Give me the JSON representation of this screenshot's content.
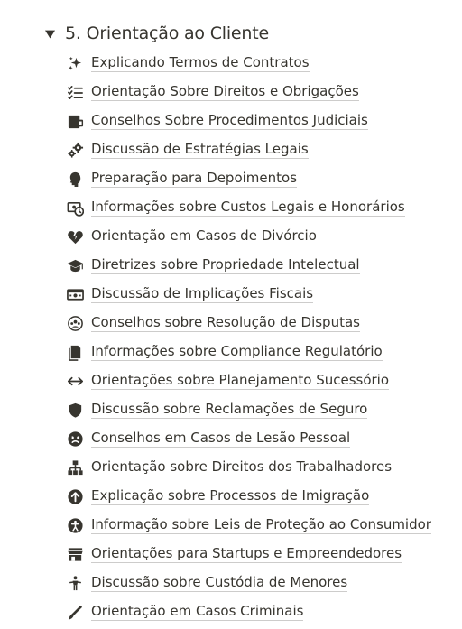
{
  "section": {
    "title": "5. Orientação ao Cliente",
    "expanded": true
  },
  "items": [
    {
      "label": "Explicando Termos de Contratos",
      "icon": "sparkles-icon"
    },
    {
      "label": "Orientação Sobre Direitos e Obrigações",
      "icon": "checklist-icon"
    },
    {
      "label": "Conselhos Sobre Procedimentos Judiciais",
      "icon": "folder-icon"
    },
    {
      "label": "Discussão de Estratégias Legais",
      "icon": "gears-icon"
    },
    {
      "label": "Preparação para Depoimentos",
      "icon": "speaking-head-icon"
    },
    {
      "label": "Informações sobre Custos Legais e Honorários",
      "icon": "money-clock-icon"
    },
    {
      "label": "Orientação em Casos de Divórcio",
      "icon": "broken-heart-icon"
    },
    {
      "label": "Diretrizes sobre Propriedade Intelectual",
      "icon": "graduation-cap-icon"
    },
    {
      "label": "Discussão de Implicações Fiscais",
      "icon": "banknote-icon"
    },
    {
      "label": "Conselhos sobre Resolução de Disputas",
      "icon": "group-circle-icon"
    },
    {
      "label": "Informações sobre Compliance Regulatório",
      "icon": "documents-icon"
    },
    {
      "label": "Orientações sobre Planejamento Sucessório",
      "icon": "arrows-horizontal-icon"
    },
    {
      "label": "Discussão sobre Reclamações de Seguro",
      "icon": "shield-icon"
    },
    {
      "label": "Conselhos em Casos de Lesão Pessoal",
      "icon": "sad-face-icon"
    },
    {
      "label": "Orientação sobre Direitos dos Trabalhadores",
      "icon": "org-chart-icon"
    },
    {
      "label": "Explicação sobre Processos de Imigração",
      "icon": "arrow-up-circle-icon"
    },
    {
      "label": "Informação sobre Leis de Proteção ao Consumidor",
      "icon": "accessibility-icon"
    },
    {
      "label": "Orientações para Startups e Empreendedores",
      "icon": "storefront-icon"
    },
    {
      "label": "Discussão sobre Custódia de Menores",
      "icon": "person-icon"
    },
    {
      "label": "Orientação em Casos Criminais",
      "icon": "pencil-icon"
    }
  ]
}
